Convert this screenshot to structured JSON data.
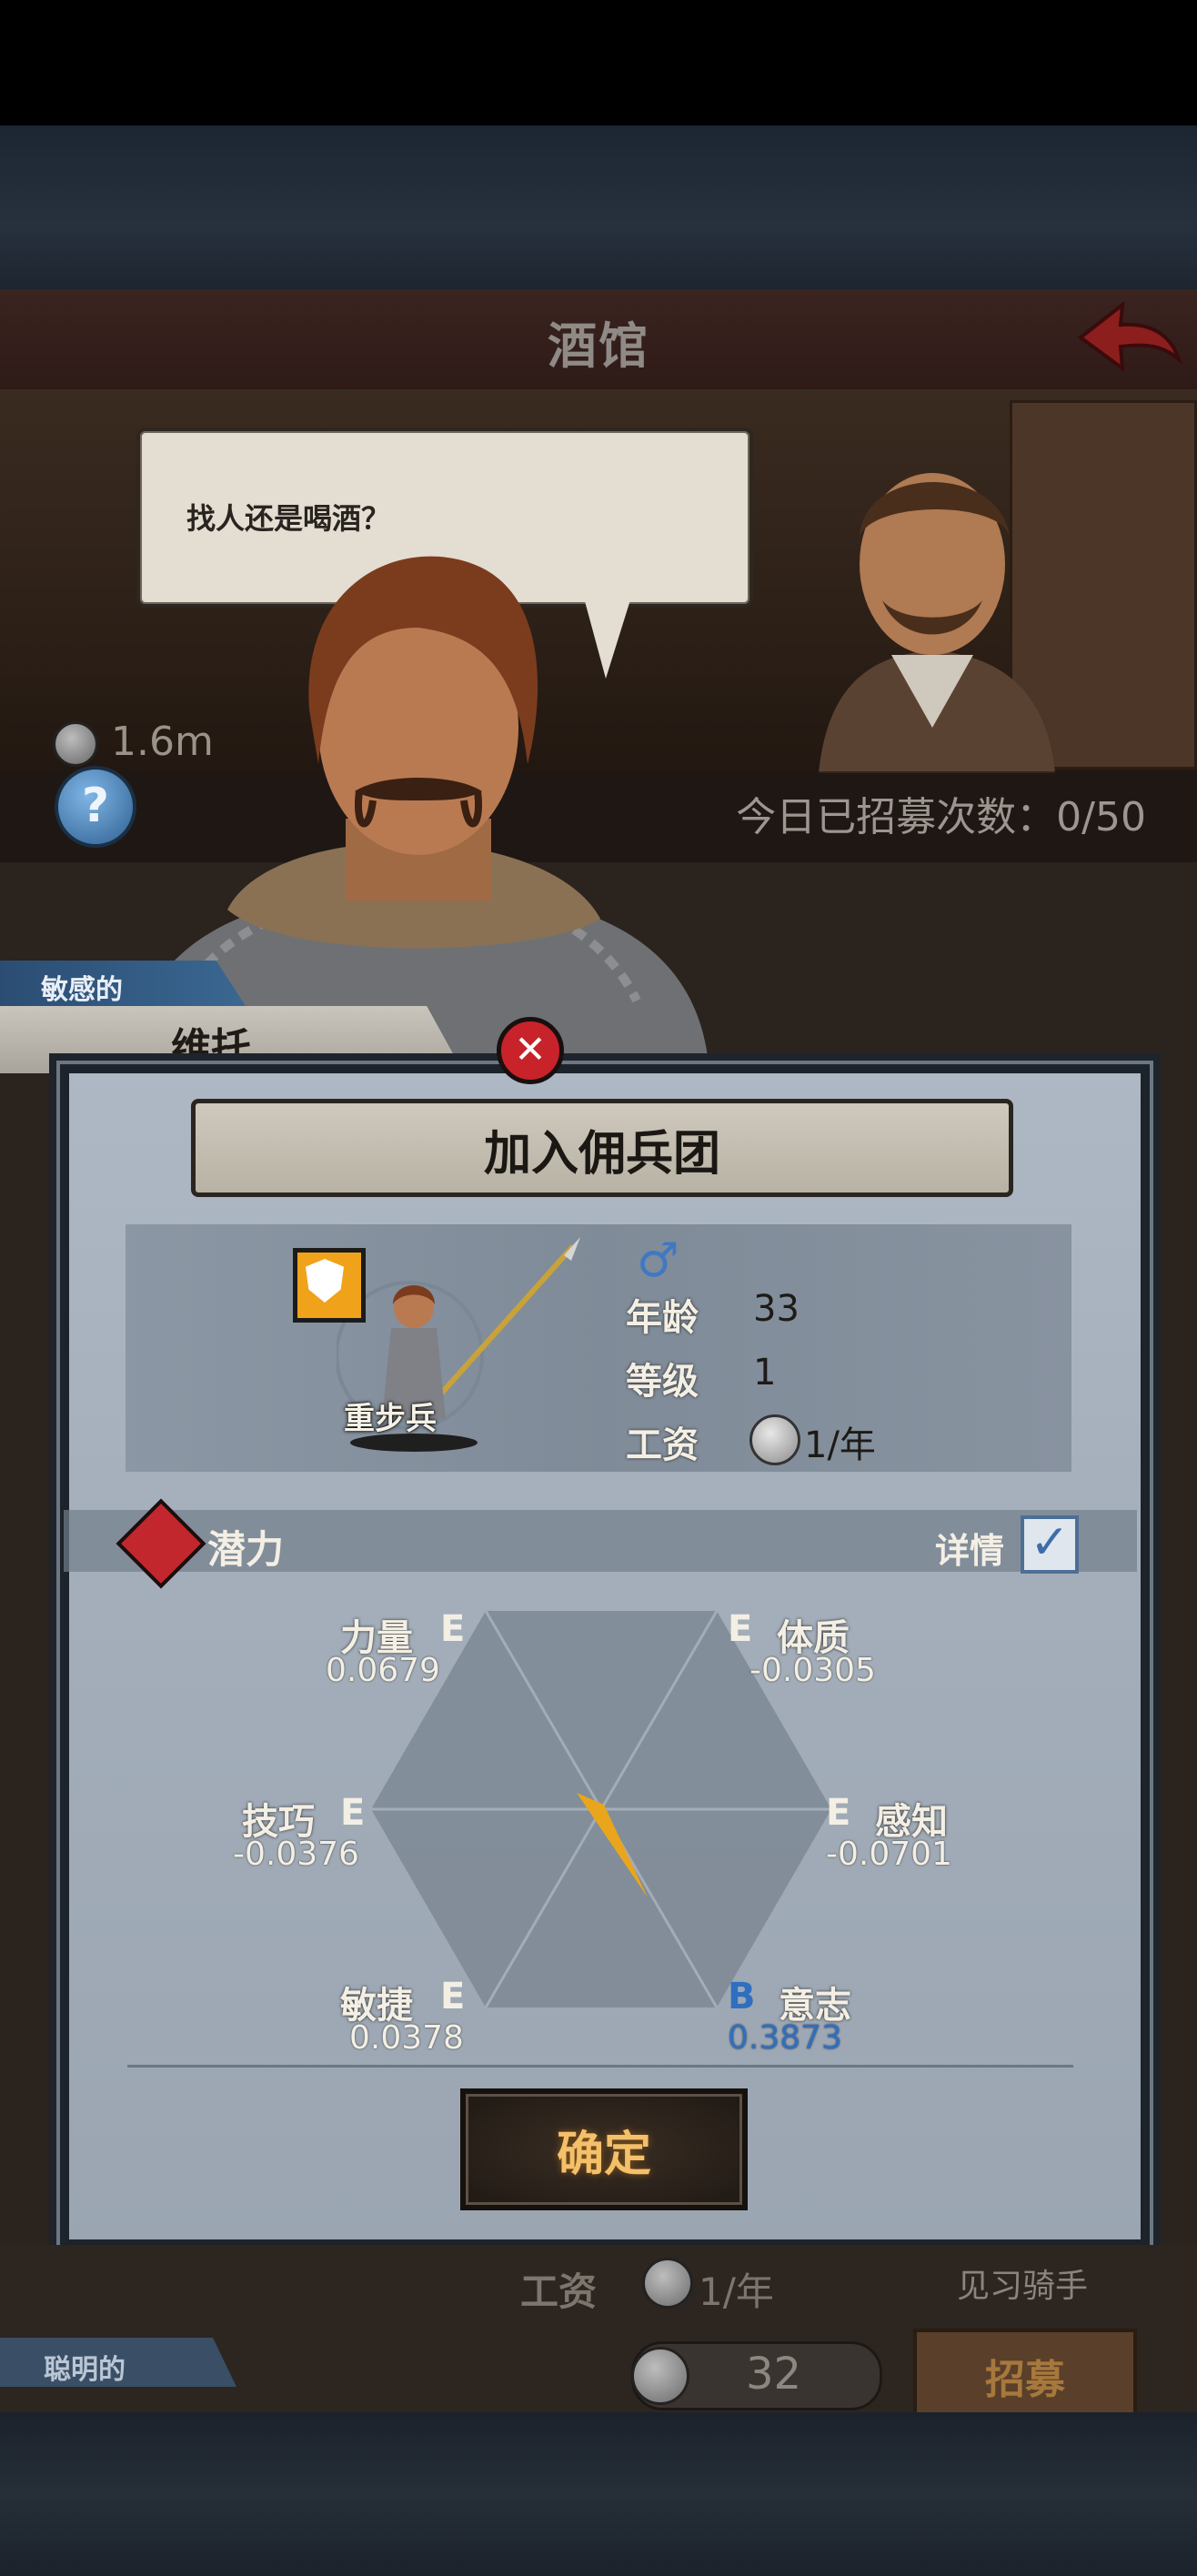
{
  "header": {
    "title": "酒馆"
  },
  "tavern": {
    "speech": "找人还是喝酒？",
    "coins": "1.6m",
    "help_label": "?",
    "recruit_count": "今日已招募次数：0/50"
  },
  "character": {
    "trait": "敏感的",
    "name": "维托",
    "close_label": "✕"
  },
  "dialog": {
    "title": "加入佣兵团",
    "unit_type": "重步兵",
    "gender": "♂",
    "age_label": "年龄",
    "age_value": "33",
    "level_label": "等级",
    "level_value": "1",
    "wage_label": "工资",
    "wage_value": "1/年",
    "potential_label": "潜力",
    "details_label": "详情",
    "details_checked": "✓",
    "attributes": [
      {
        "name": "力量",
        "grade": "E",
        "value": "0.0679"
      },
      {
        "name": "体质",
        "grade": "E",
        "value": "-0.0305"
      },
      {
        "name": "技巧",
        "grade": "E",
        "value": "-0.0376"
      },
      {
        "name": "感知",
        "grade": "E",
        "value": "-0.0701"
      },
      {
        "name": "敏捷",
        "grade": "E",
        "value": "0.0378"
      },
      {
        "name": "意志",
        "grade": "B",
        "value": "0.3873"
      }
    ],
    "confirm_label": "确定"
  },
  "background_card": {
    "wage_label": "工资",
    "wage_value": "1/年",
    "title": "见习骑手",
    "trait": "聪明的",
    "cost": "32",
    "recruit_label": "招募"
  },
  "colors": {
    "accent_blue": "#2f6fc0",
    "close_red": "#c8232a",
    "confirm_gold": "#f4c06a",
    "unit_badge": "#f0a21a"
  },
  "icons": [
    "back-arrow-icon",
    "coin-icon",
    "help-icon",
    "close-icon",
    "shield-icon",
    "male-icon",
    "potential-icon",
    "checkbox-icon"
  ]
}
